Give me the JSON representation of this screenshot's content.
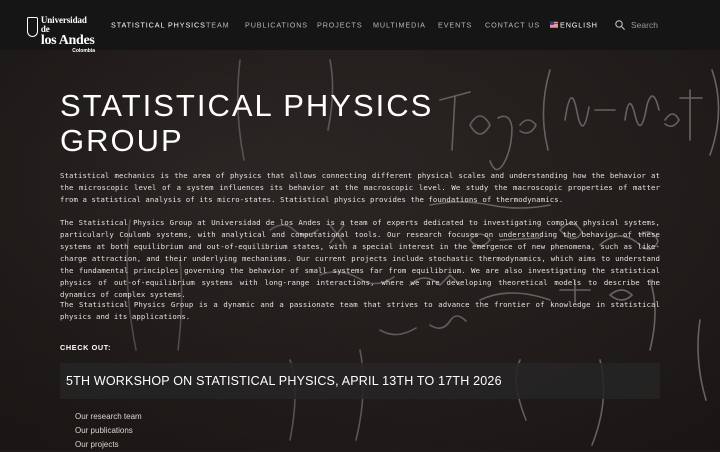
{
  "brand": {
    "line1": "Universidad de",
    "line2": "los Andes",
    "line3": "Colombia"
  },
  "nav": {
    "items": [
      {
        "label": "STATISTICAL PHYSICS",
        "active": true
      },
      {
        "label": "TEAM"
      },
      {
        "label": "PUBLICATIONS"
      },
      {
        "label": "PROJECTS"
      },
      {
        "label": "MULTIMEDIA"
      },
      {
        "label": "EVENTS"
      },
      {
        "label": "CONTACT US"
      },
      {
        "label": "ENGLISH"
      }
    ],
    "search_placeholder": "Search"
  },
  "main": {
    "title_line1": "STATISTICAL PHYSICS",
    "title_line2": "GROUP",
    "paragraphs": [
      "Statistical mechanics is the area of physics that allows connecting different physical scales and understanding how the behavior at the microscopic level of a system influences its behavior at the macroscopic level. We study the macroscopic properties of matter from a statistical analysis of its micro-states. Statistical physics provides the foundations of thermodynamics.",
      "The Statistical Physics Group at Universidad de los Andes is a team of experts dedicated to investigating complex physical systems, particularly Coulomb systems, with analytical and computational tools. Our research focuses on understanding the behavior of these systems at both equilibrium and out-of-equilibrium states, with a special interest in the emergence of new phenomena, such as like-charge attraction, and their underlying mechanisms. Our current projects include stochastic thermodynamics, which aims to understand the fundamental principles governing the behavior of small systems far from equilibrium. We are also investigating the statistical physics of out-of-equilibrium systems with long-range interactions, where we are developing theoretical models to describe the dynamics of complex systems.",
      "The Statistical Physics Group is a dynamic and a passionate team that strives to advance the frontier of knowledge in statistical physics and its applications."
    ],
    "checkout_label": "CHECK OUT:",
    "workshop_banner": "5TH WORKSHOP ON STATISTICAL PHYSICS, APRIL 13TH TO 17TH 2026",
    "links": [
      "Our research team",
      "Our publications",
      "Our projects"
    ]
  },
  "colors": {
    "navbar": "#151515",
    "banner": "#262424",
    "text": "#ffffff"
  },
  "icons": [
    "university-shield-icon",
    "us-flag-icon",
    "search-icon"
  ]
}
